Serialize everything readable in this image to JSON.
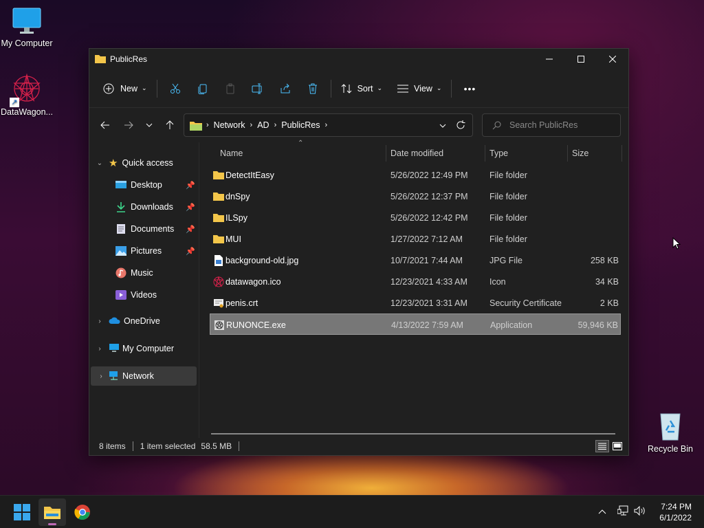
{
  "desktop": {
    "icons": [
      {
        "label": "My Computer"
      },
      {
        "label": "DataWagon..."
      },
      {
        "label": "Recycle Bin"
      }
    ]
  },
  "window": {
    "title": "PublicRes",
    "controls": {
      "minimize": "minimize-icon",
      "maximize": "maximize-icon",
      "close": "close-icon"
    }
  },
  "toolbar": {
    "new_label": "New",
    "sort_label": "Sort",
    "view_label": "View",
    "more_label": "•••"
  },
  "address": {
    "crumbs": [
      "Network",
      "AD",
      "PublicRes"
    ]
  },
  "search": {
    "placeholder": "Search PublicRes"
  },
  "nav": {
    "quick_access": "Quick access",
    "items": [
      {
        "label": "Desktop",
        "icon": "desktop-icon",
        "pinned": true
      },
      {
        "label": "Downloads",
        "icon": "download-icon",
        "pinned": true
      },
      {
        "label": "Documents",
        "icon": "documents-icon",
        "pinned": true
      },
      {
        "label": "Pictures",
        "icon": "pictures-icon",
        "pinned": true
      },
      {
        "label": "Music",
        "icon": "music-icon",
        "pinned": false
      },
      {
        "label": "Videos",
        "icon": "videos-icon",
        "pinned": false
      }
    ],
    "onedrive": "OneDrive",
    "my_computer": "My Computer",
    "network": "Network"
  },
  "columns": {
    "name": "Name",
    "date": "Date modified",
    "type": "Type",
    "size": "Size"
  },
  "files": [
    {
      "name": "DetectItEasy",
      "date": "5/26/2022 12:49 PM",
      "type": "File folder",
      "size": "",
      "icon": "folder-icon"
    },
    {
      "name": "dnSpy",
      "date": "5/26/2022 12:37 PM",
      "type": "File folder",
      "size": "",
      "icon": "folder-icon"
    },
    {
      "name": "ILSpy",
      "date": "5/26/2022 12:42 PM",
      "type": "File folder",
      "size": "",
      "icon": "folder-icon"
    },
    {
      "name": "MUI",
      "date": "1/27/2022 7:12 AM",
      "type": "File folder",
      "size": "",
      "icon": "folder-icon"
    },
    {
      "name": "background-old.jpg",
      "date": "10/7/2021 7:44 AM",
      "type": "JPG File",
      "size": "258 KB",
      "icon": "image-file-icon"
    },
    {
      "name": "datawagon.ico",
      "date": "12/23/2021 4:33 AM",
      "type": "Icon",
      "size": "34 KB",
      "icon": "ico-file-icon"
    },
    {
      "name": "penis.crt",
      "date": "12/23/2021 3:31 AM",
      "type": "Security Certificate",
      "size": "2 KB",
      "icon": "certificate-file-icon"
    },
    {
      "name": "RUNONCE.exe",
      "date": "4/13/2022 7:59 AM",
      "type": "Application",
      "size": "59,946 KB",
      "icon": "exe-file-icon",
      "selected": true
    }
  ],
  "status": {
    "count": "8 items",
    "selection": "1 item selected",
    "size": "58.5 MB"
  },
  "taskbar": {
    "time": "7:24 PM",
    "date": "6/1/2022"
  },
  "colors": {
    "folder": "#f3c64a",
    "accent": "#4cc2ff",
    "selected_row": "#777777"
  }
}
